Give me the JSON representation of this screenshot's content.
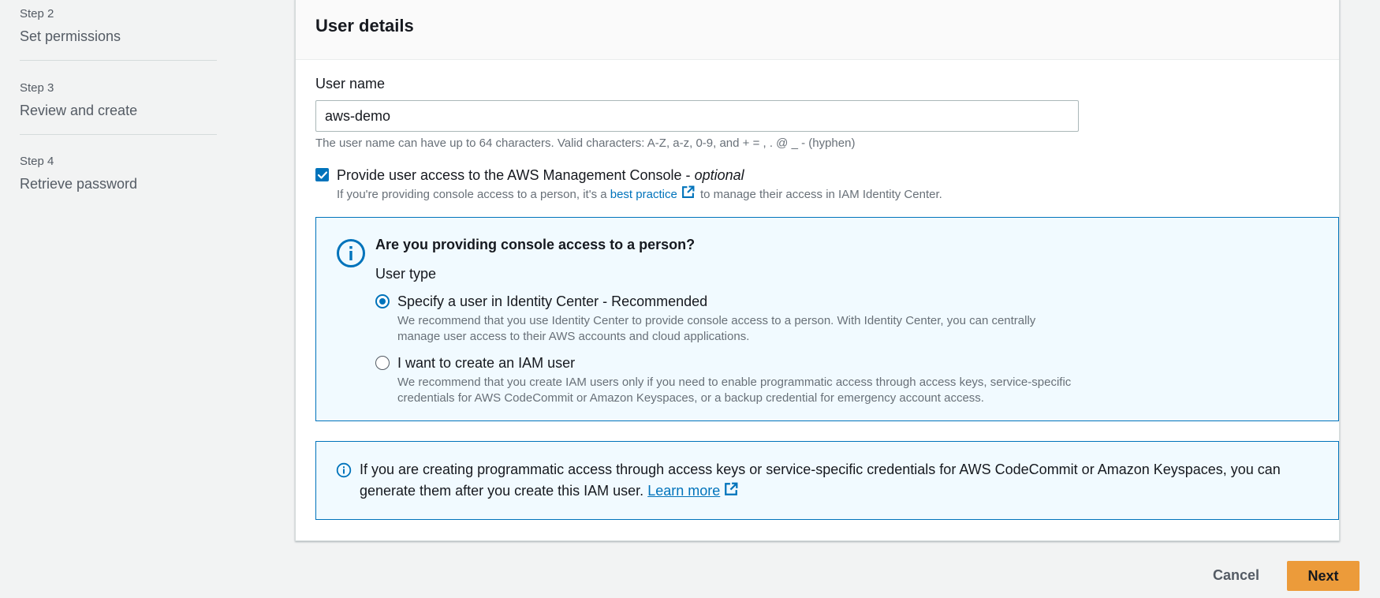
{
  "steps": [
    {
      "step": "Step 2",
      "title": "Set permissions"
    },
    {
      "step": "Step 3",
      "title": "Review and create"
    },
    {
      "step": "Step 4",
      "title": "Retrieve password"
    }
  ],
  "user_details": {
    "heading": "User details",
    "username_label": "User name",
    "username_value": "aws-demo",
    "username_hint": "The user name can have up to 64 characters. Valid characters: A-Z, a-z, 0-9, and + = , . @ _ - (hyphen)",
    "console_access": {
      "checked": true,
      "label": "Provide user access to the AWS Management Console - ",
      "label_optional": "optional",
      "desc_before": "If you're providing console access to a person, it's a ",
      "desc_link": "best practice",
      "desc_after": " to manage their access in IAM Identity Center."
    }
  },
  "person_box": {
    "title": "Are you providing console access to a person?",
    "user_type_label": "User type",
    "options": [
      {
        "label": "Specify a user in Identity Center - Recommended",
        "desc": "We recommend that you use Identity Center to provide console access to a person. With Identity Center, you can centrally manage user access to their AWS accounts and cloud applications.",
        "selected": true
      },
      {
        "label": "I want to create an IAM user",
        "desc": "We recommend that you create IAM users only if you need to enable programmatic access through access keys, service-specific credentials for AWS CodeCommit or Amazon Keyspaces, or a backup credential for emergency account access.",
        "selected": false
      }
    ]
  },
  "programmatic_box": {
    "text": "If you are creating programmatic access through access keys or service-specific credentials for AWS CodeCommit or Amazon Keyspaces, you can generate them after you create this IAM user. ",
    "link": "Learn more"
  },
  "footer": {
    "cancel_label": "Cancel",
    "next_label": "Next"
  },
  "colors": {
    "accent": "#0073bb",
    "primary_button": "#ec9b3a",
    "info_bg": "#f1faff"
  },
  "icons": {
    "checkbox": "check-icon",
    "external": "external-link-icon",
    "info": "info-circle-icon"
  }
}
